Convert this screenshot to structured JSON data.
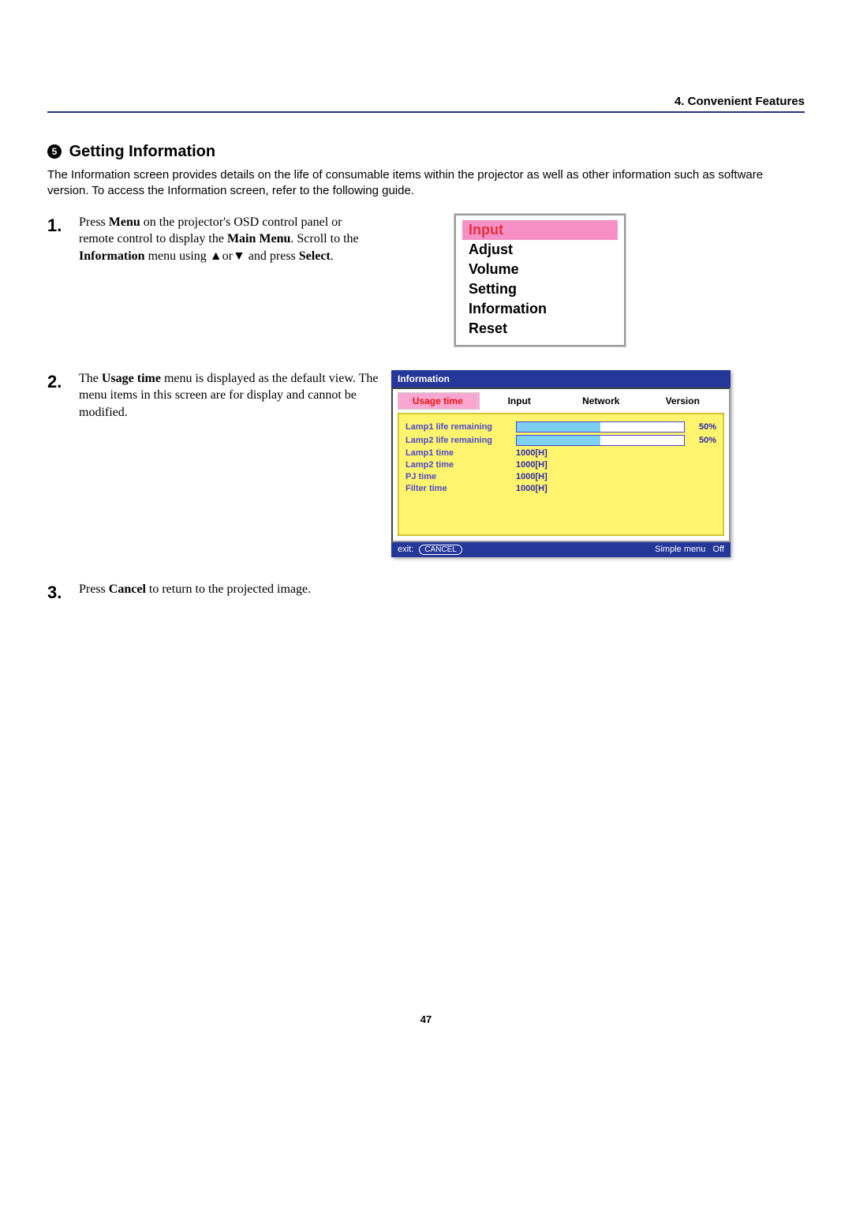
{
  "header": {
    "section": "4. Convenient Features"
  },
  "title_marker": "5",
  "title": "Getting Information",
  "intro": "The Information screen provides details on the life of consumable items within the projector as well as other information such as software version. To access the Information screen, refer to the following guide.",
  "steps": {
    "s1": {
      "num": "1.",
      "pre": "Press ",
      "b1": "Menu",
      "mid1": " on the projector's OSD control panel or remote control to display the ",
      "b2": "Main Menu",
      "mid2": ". Scroll to the ",
      "b3": "Information",
      "mid3": " menu using ▲or▼ and press ",
      "b4": "Select",
      "post": "."
    },
    "s2": {
      "num": "2.",
      "pre": "The ",
      "b1": "Usage time",
      "post": " menu is displayed as the default view. The menu items in this screen are for display and cannot be modified."
    },
    "s3": {
      "num": "3.",
      "pre": "Press ",
      "b1": "Cancel",
      "post": " to return to the projected image."
    }
  },
  "main_menu": {
    "items": [
      "Input",
      "Adjust",
      "Volume",
      "Setting",
      "Information",
      "Reset"
    ],
    "selected_index": 0
  },
  "info_panel": {
    "title": "Information",
    "tabs": [
      "Usage time",
      "Input",
      "Network",
      "Version"
    ],
    "active_tab": 0,
    "rows": [
      {
        "label": "Lamp1 life remaining",
        "type": "bar",
        "pct": "50%",
        "fill": 50
      },
      {
        "label": "Lamp2 life remaining",
        "type": "bar",
        "pct": "50%",
        "fill": 50
      },
      {
        "label": "Lamp1 time",
        "type": "text",
        "value": "1000[H]"
      },
      {
        "label": "Lamp2 time",
        "type": "text",
        "value": "1000[H]"
      },
      {
        "label": "PJ time",
        "type": "text",
        "value": "1000[H]"
      },
      {
        "label": "Filter time",
        "type": "text",
        "value": "1000[H]"
      }
    ],
    "footer": {
      "exit_label": "exit:",
      "exit_button": "CANCEL",
      "mode_label": "Simple menu",
      "mode_value": "Off"
    }
  },
  "page_number": "47"
}
